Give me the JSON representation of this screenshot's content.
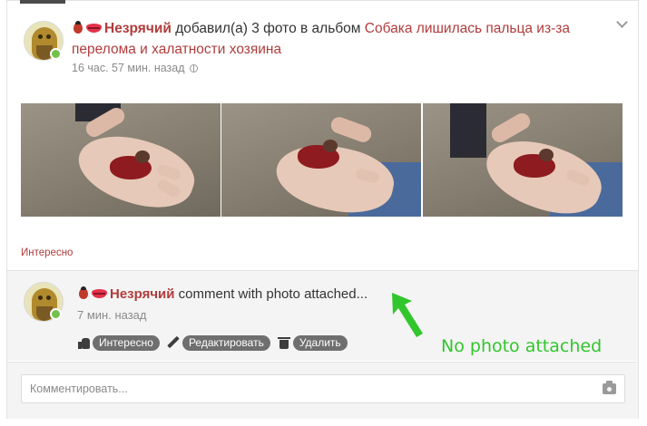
{
  "post": {
    "author": "Незрячий",
    "action_text": "добавил(а) 3 фото в альбом",
    "album_title": "Собака лишилась пальца из-за перелома и халатности хозяина",
    "time": "16 час. 57 мин. назад",
    "interesting_label": "Интересно",
    "photos": [
      {
        "icon": "photo-hand-with-paw"
      },
      {
        "icon": "photo-hand-with-paw"
      },
      {
        "icon": "photo-hand-with-paw"
      }
    ]
  },
  "comment": {
    "author": "Незрячий",
    "text": "comment with photo attached...",
    "time": "7 мин. назад",
    "actions": {
      "like_label": "Интересно",
      "edit_label": "Редактировать",
      "delete_label": "Удалить"
    }
  },
  "annotation": {
    "text": "No photo attached",
    "color": "#31c62c"
  },
  "comment_form": {
    "placeholder": "Комментировать..."
  },
  "colors": {
    "link": "#b13c3c",
    "pill_bg": "#6f6f6f",
    "online": "#72c14b"
  }
}
